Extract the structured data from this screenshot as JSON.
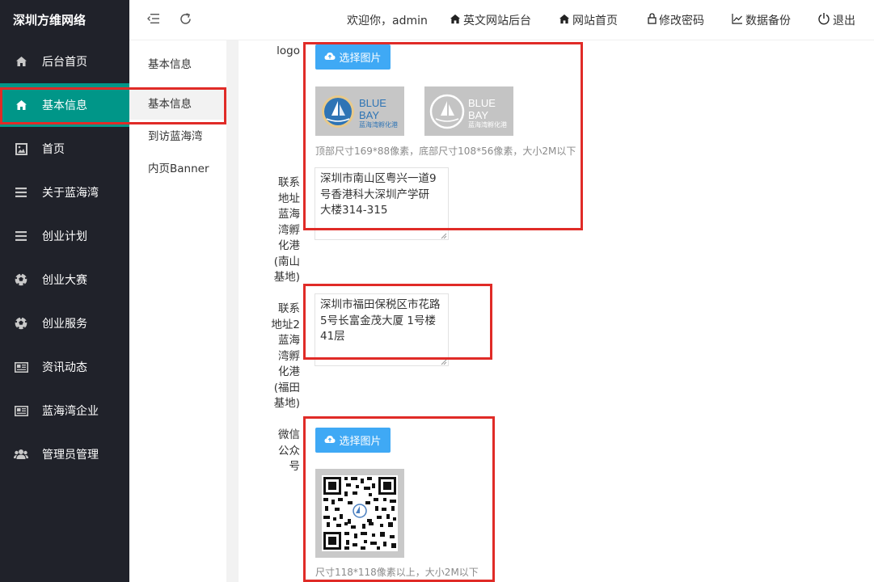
{
  "brand": "深圳方维网络",
  "sidebar": {
    "items": [
      {
        "label": "后台首页",
        "icon": "home-icon"
      },
      {
        "label": "基本信息",
        "icon": "home-icon"
      },
      {
        "label": "首页",
        "icon": "image-icon"
      },
      {
        "label": "关于蓝海湾",
        "icon": "list-icon"
      },
      {
        "label": "创业计划",
        "icon": "list-icon"
      },
      {
        "label": "创业大赛",
        "icon": "soccer-icon"
      },
      {
        "label": "创业服务",
        "icon": "soccer-icon"
      },
      {
        "label": "资讯动态",
        "icon": "newspaper-icon"
      },
      {
        "label": "蓝海湾企业",
        "icon": "newspaper-icon"
      },
      {
        "label": "管理员管理",
        "icon": "users-icon"
      }
    ]
  },
  "header": {
    "welcome": "欢迎你，admin",
    "links": [
      {
        "label": "英文网站后台",
        "icon": "home-icon"
      },
      {
        "label": "网站首页",
        "icon": "home-icon"
      },
      {
        "label": "修改密码",
        "icon": "lock-icon"
      },
      {
        "label": "数据备份",
        "icon": "chart-icon"
      },
      {
        "label": "退出",
        "icon": "power-icon"
      }
    ]
  },
  "subnav": {
    "items": [
      {
        "label": "基本信息"
      },
      {
        "label": "基本信息"
      },
      {
        "label": "到访蓝海湾"
      },
      {
        "label": "内页Banner"
      }
    ]
  },
  "form": {
    "logo_label": "logo",
    "upload_label": "选择图片",
    "logo_hint": "顶部尺寸169*88像素，底部尺寸108*56像素，大小2M以下",
    "logo_text": "BLUE BAY",
    "logo_subtext": "蓝海湾孵化港",
    "addr1_label": "联系地址蓝海湾孵化港(南山基地)",
    "addr1_label_lines": [
      "联系",
      "地址",
      "蓝海",
      "湾孵",
      "化港",
      "(南山",
      "基地)"
    ],
    "addr1_value": "深圳市南山区粤兴一道9\n号香港科大深圳产学研\n大楼314-315",
    "addr2_label": "联系地址2蓝海湾孵化港(福田基地)",
    "addr2_label_lines": [
      "联系",
      "地址2",
      "蓝海",
      "湾孵",
      "化港",
      "(福田",
      "基地)"
    ],
    "addr2_value": "深圳市福田保税区市花路\n5号长富金茂大厦 1号楼\n41层",
    "wechat_label": "微信公众号",
    "wechat_label_lines": [
      "微信",
      "公众",
      "号"
    ],
    "wechat_hint": "尺寸118*118像素以上，大小2M以下"
  },
  "colors": {
    "sidebar_bg": "#20222a",
    "active_green": "#009688",
    "upload_blue": "#3fa9f5",
    "highlight_red": "#e02b27"
  }
}
